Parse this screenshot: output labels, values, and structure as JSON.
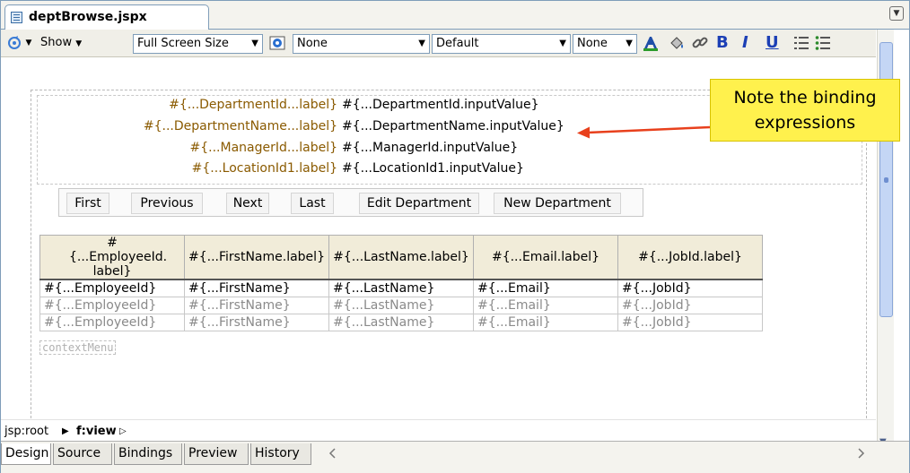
{
  "doc_tab": {
    "title": "deptBrowse.jspx"
  },
  "toolbar": {
    "show_label": "Show",
    "screen_size": "Full Screen Size",
    "combo_none_1": "None",
    "combo_default": "Default",
    "combo_none_2": "None",
    "format_bold": "B",
    "format_italic": "I",
    "format_underline": "U"
  },
  "form": {
    "rows": [
      {
        "label": "#{...DepartmentId...label}",
        "value": "#{...DepartmentId.inputValue}"
      },
      {
        "label": "#{...DepartmentName...label}",
        "value": "#{...DepartmentName.inputValue}"
      },
      {
        "label": "#{...ManagerId...label}",
        "value": "#{...ManagerId.inputValue}"
      },
      {
        "label": "#{...LocationId1.label}",
        "value": "#{...LocationId1.inputValue}"
      }
    ]
  },
  "buttons": {
    "first": "First",
    "previous": "Previous",
    "next": "Next",
    "last": "Last",
    "edit": "Edit Department",
    "new": "New Department"
  },
  "table": {
    "headers": [
      "#{...EmployeeId. label}",
      "#{...FirstName.label}",
      "#{...LastName.label}",
      "#{...Email.label}",
      "#{...JobId.label}"
    ],
    "rows": [
      [
        "#{...EmployeeId}",
        "#{...FirstName}",
        "#{...LastName}",
        "#{...Email}",
        "#{...JobId}"
      ],
      [
        "#{...EmployeeId}",
        "#{...FirstName}",
        "#{...LastName}",
        "#{...Email}",
        "#{...JobId}"
      ],
      [
        "#{...EmployeeId}",
        "#{...FirstName}",
        "#{...LastName}",
        "#{...Email}",
        "#{...JobId}"
      ]
    ]
  },
  "context_menu": "contextMenu",
  "callout": {
    "line1": "Note the binding",
    "line2": "expressions"
  },
  "breadcrumb": {
    "root": "jsp:root",
    "view": "f:view"
  },
  "bottom_tabs": [
    "Design",
    "Source",
    "Bindings",
    "Preview",
    "History"
  ],
  "colors": {
    "callout_bg": "#fff14d",
    "arrow": "#e8401c",
    "label_text": "#8a5a00",
    "header_bg": "#f1ecd9"
  }
}
